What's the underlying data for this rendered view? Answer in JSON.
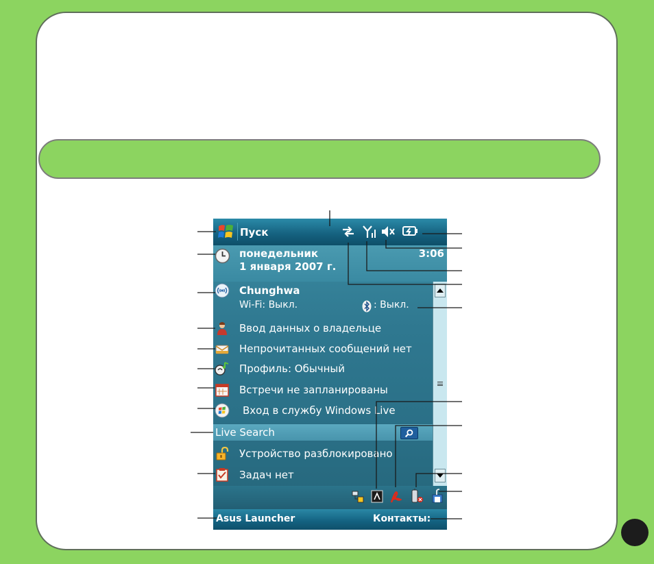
{
  "screen": {
    "start_label": "Пуск",
    "today": {
      "day": "понедельник",
      "date": "1 января 2007 г.",
      "time": "3:06"
    },
    "connection": {
      "operator": "Chunghwa",
      "wifi": "Wi-Fi: Выкл.",
      "bluetooth": ": Выкл."
    },
    "items": [
      "Ввод данных о владельце",
      "Непрочитанных сообщений нет",
      "Профиль: Обычный",
      "Встречи не запланированы",
      "Вход в службу Windows Live"
    ],
    "search_label": "Live Search",
    "items_after_search": [
      "Устройство разблокировано",
      "Задач нет"
    ],
    "softkeys": {
      "left": "Asus Launcher",
      "right": "Контакты:"
    }
  },
  "icons": {
    "start": "windows-flag-icon",
    "tray": [
      "connectivity-arrows-icon",
      "signal-strength-icon",
      "speaker-muted-icon",
      "battery-charging-icon"
    ],
    "rows": [
      "clock-icon",
      "wireless-manager-icon",
      "owner-icon",
      "messages-icon",
      "profile-icon",
      "calendar-icon",
      "windows-live-icon",
      "lock-icon",
      "tasks-icon"
    ],
    "bottom_tray": [
      "network-icon",
      "usb-icon",
      "acrobat-icon",
      "bluetooth-device-icon",
      "storage-icon"
    ]
  },
  "colors": {
    "background": "#8cd460",
    "card": "#ffffff",
    "screen": "#2f7890",
    "title_bar": "#14607e"
  }
}
